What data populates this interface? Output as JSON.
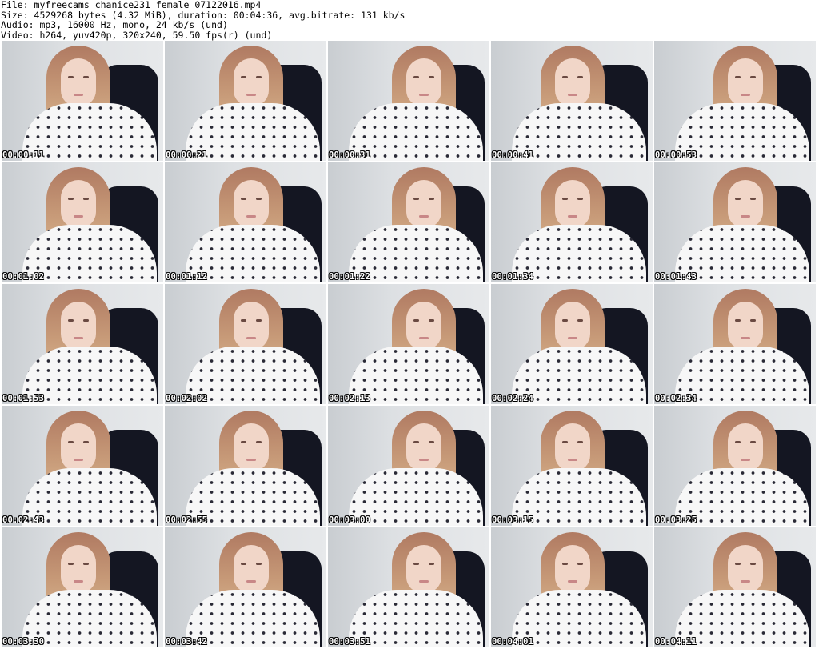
{
  "header": {
    "file_line": "File: myfreecams_chanice231_female_07122016.mp4",
    "size_line": "Size: 4529268 bytes (4.32 MiB), duration: 00:04:36, avg.bitrate: 131 kb/s",
    "audio_line": "Audio: mp3, 16000 Hz, mono, 24 kb/s (und)",
    "video_line": "Video: h264, yuv420p, 320x240, 59.50 fps(r) (und)"
  },
  "thumbnails": [
    {
      "timestamp": "00:00:11"
    },
    {
      "timestamp": "00:00:21"
    },
    {
      "timestamp": "00:00:31"
    },
    {
      "timestamp": "00:00:41"
    },
    {
      "timestamp": "00:00:53"
    },
    {
      "timestamp": "00:01:02"
    },
    {
      "timestamp": "00:01:12"
    },
    {
      "timestamp": "00:01:22"
    },
    {
      "timestamp": "00:01:34"
    },
    {
      "timestamp": "00:01:43"
    },
    {
      "timestamp": "00:01:53"
    },
    {
      "timestamp": "00:02:02"
    },
    {
      "timestamp": "00:02:13"
    },
    {
      "timestamp": "00:02:24"
    },
    {
      "timestamp": "00:02:34"
    },
    {
      "timestamp": "00:02:43"
    },
    {
      "timestamp": "00:02:55"
    },
    {
      "timestamp": "00:03:00"
    },
    {
      "timestamp": "00:03:15"
    },
    {
      "timestamp": "00:03:25"
    },
    {
      "timestamp": "00:03:30"
    },
    {
      "timestamp": "00:03:42"
    },
    {
      "timestamp": "00:03:51"
    },
    {
      "timestamp": "00:04:01"
    },
    {
      "timestamp": "00:04:11"
    }
  ]
}
